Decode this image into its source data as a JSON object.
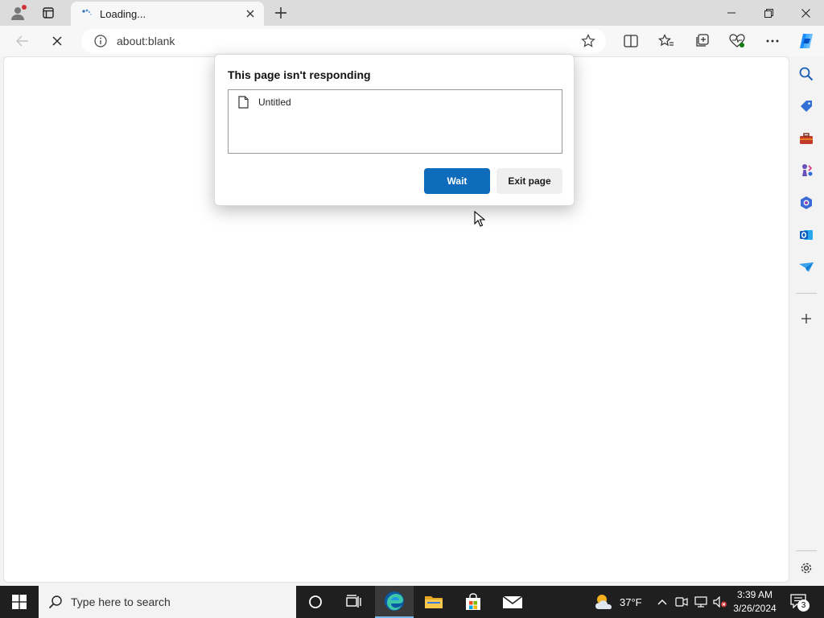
{
  "tab": {
    "title": "Loading..."
  },
  "address_bar": {
    "url": "about:blank"
  },
  "dialog": {
    "title": "This page isn't responding",
    "pages": [
      {
        "label": "Untitled"
      }
    ],
    "wait_label": "Wait",
    "exit_label": "Exit page"
  },
  "taskbar": {
    "search_placeholder": "Type here to search",
    "weather_temp": "37°F",
    "time": "3:39 AM",
    "date": "3/26/2024",
    "notification_count": "3"
  },
  "colors": {
    "accent": "#0f6cbd",
    "taskbar": "#1f1f1f",
    "profile_dot": "#d13438"
  }
}
